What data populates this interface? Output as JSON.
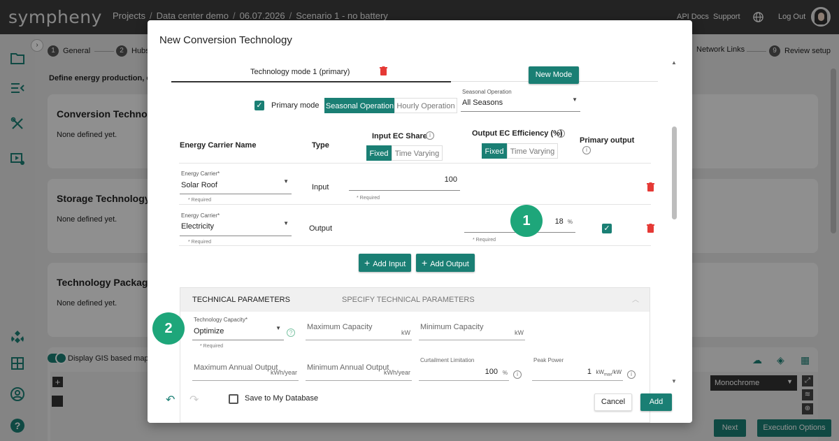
{
  "app": {
    "logo": "sympheny"
  },
  "breadcrumb": [
    "Projects",
    "Data center demo",
    "06.07.2026",
    "Scenario 1 - no battery"
  ],
  "topbar": {
    "api_docs": "API Docs",
    "support": "Support",
    "log_out": "Log Out"
  },
  "stepper": {
    "steps": [
      {
        "num": "1",
        "label": "General"
      },
      {
        "num": "2",
        "label": "Hubs"
      },
      {
        "label": "Network Links"
      },
      {
        "num": "9",
        "label": "Review setup"
      }
    ]
  },
  "page": {
    "define_text": "Define energy production, conv",
    "cards": [
      {
        "title": "Conversion Technolo",
        "text": "None defined yet."
      },
      {
        "title": "Storage Technology",
        "text": "None defined yet."
      },
      {
        "title": "Technology Package",
        "text": "None defined yet."
      }
    ],
    "gis_label": "Display GIS based map",
    "map_style": "Monochrome",
    "next": "Next",
    "execution_options": "Execution Options"
  },
  "dialog": {
    "title": "New Conversion Technology",
    "mode_tab": "Technology mode 1 (primary)",
    "new_mode": "New Mode",
    "primary_mode_label": "Primary mode",
    "seasonal_operation_btn": "Seasonal Operation",
    "hourly_operation_btn": "Hourly Operation",
    "seasonal_select": {
      "label": "Seasonal Operation",
      "value": "All Seasons"
    },
    "columns": {
      "carrier": "Energy Carrier Name",
      "type": "Type",
      "input_share": "Input EC Share",
      "output_eff": "Output EC Efficiency (%)",
      "primary_output": "Primary output",
      "fixed": "Fixed",
      "time_varying": "Time Varying"
    },
    "rows": [
      {
        "carrier_label": "Energy Carrier*",
        "carrier": "Solar Roof",
        "required": "* Required",
        "type": "Input",
        "value": "100",
        "value_required": "* Required"
      },
      {
        "carrier_label": "Energy Carrier*",
        "carrier": "Electricity",
        "required": "* Required",
        "type": "Output",
        "value": "18",
        "unit": "%",
        "value_required": "* Required"
      }
    ],
    "add_input": "Add Input",
    "add_output": "Add Output",
    "tech_params": {
      "title": "TECHNICAL PARAMETERS",
      "subtitle": "SPECIFY TECHNICAL PARAMETERS",
      "capacity": {
        "label": "Technology Capacity*",
        "value": "Optimize",
        "required": "* Required"
      },
      "max_capacity": {
        "placeholder": "Maximum Capacity",
        "unit": "kW"
      },
      "min_capacity": {
        "placeholder": "Minimum Capacity",
        "unit": "kW"
      },
      "max_annual": {
        "placeholder": "Maximum Annual Output",
        "unit": "kWh/year"
      },
      "min_annual": {
        "placeholder": "Minimum Annual Output",
        "unit": "kWh/year"
      },
      "curtailment": {
        "label": "Curtailment Limitation",
        "value": "100",
        "unit": "%"
      },
      "peak_power": {
        "label": "Peak Power",
        "value": "1",
        "unit_main": "kW",
        "unit_sub": "max",
        "unit_tail": "/kW"
      }
    },
    "save_db": "Save to My Database",
    "cancel": "Cancel",
    "add": "Add"
  },
  "badges": [
    "1",
    "2"
  ],
  "colors": {
    "accent": "#1a7f74",
    "delete": "#e53935",
    "badge": "#1ea67a",
    "topbar": "#3d3d3d"
  }
}
